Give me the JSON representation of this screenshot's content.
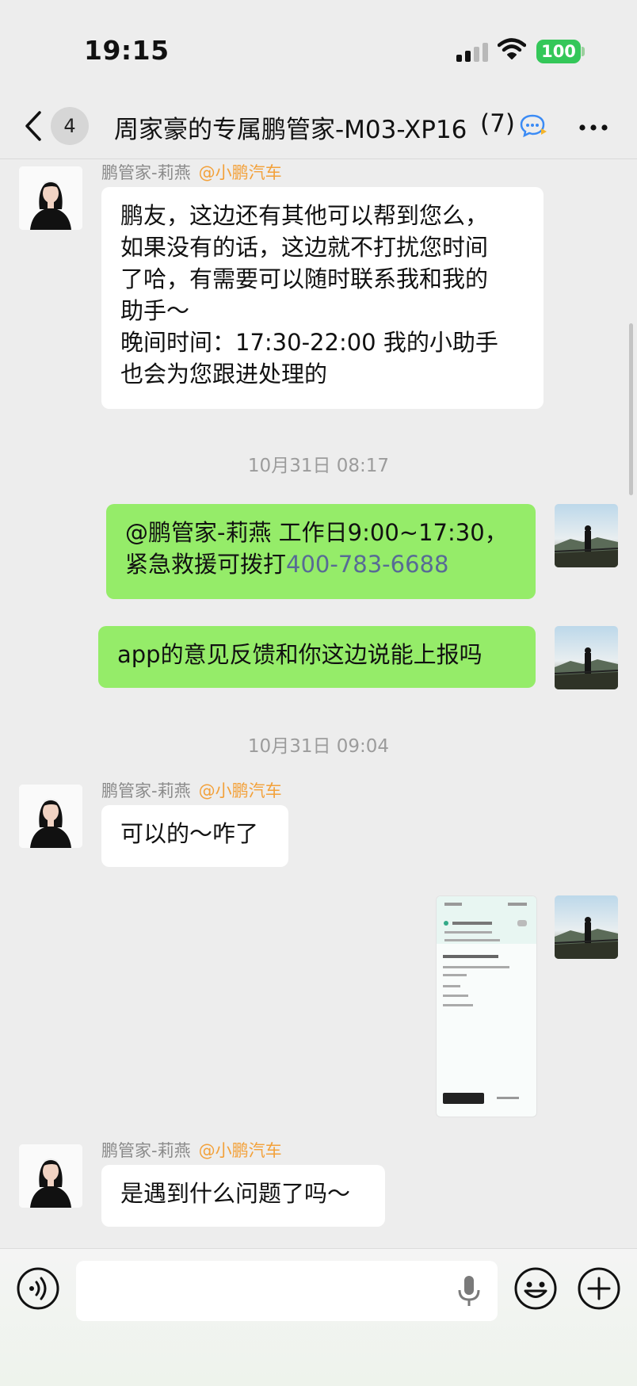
{
  "status_bar": {
    "time": "19:15",
    "battery": "100"
  },
  "nav": {
    "unread_count": "4",
    "title": "周家豪的专属鹏管家-M03-XP16",
    "member_count": "(7)"
  },
  "messages": [
    {
      "sender": "鹏管家-莉燕",
      "org": "@小鹏汽车",
      "lines": [
        "鹏友，这边还有其他可以帮到您么，",
        "如果没有的话，这边就不打扰您时间",
        "了哈，有需要可以随时联系我和我的",
        "助手～",
        "晚间时间：17:30-22:00 我的小助手",
        "也会为您跟进处理的"
      ]
    },
    {
      "timestamp": "10月31日 08:17"
    },
    {
      "line1": "@鹏管家-莉燕 工作日9:00~17:30，",
      "line2_prefix": "紧急救援可拨打",
      "phone": "400-783-6688"
    },
    {
      "text": "app的意见反馈和你这边说能上报吗"
    },
    {
      "timestamp": "10月31日 09:04"
    },
    {
      "sender": "鹏管家-莉燕",
      "org": "@小鹏汽车",
      "text": "可以的～咋了"
    },
    {
      "image": "screenshot-thumbnail"
    },
    {
      "sender": "鹏管家-莉燕",
      "org": "@小鹏汽车",
      "text": "是遇到什么问题了吗～"
    }
  ],
  "input": {
    "placeholder": ""
  }
}
